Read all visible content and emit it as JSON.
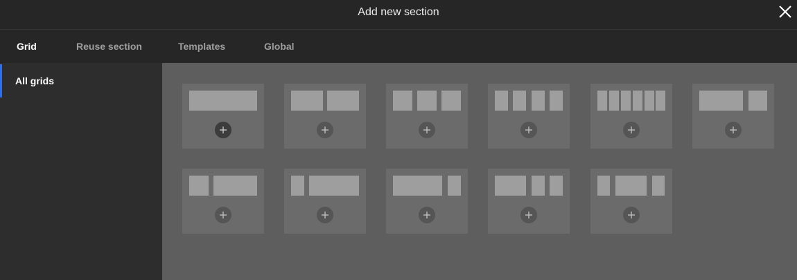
{
  "header": {
    "title": "Add new section",
    "close_icon": "close-icon"
  },
  "tabs": [
    {
      "label": "Grid",
      "active": true
    },
    {
      "label": "Reuse section",
      "active": false
    },
    {
      "label": "Templates",
      "active": false
    },
    {
      "label": "Global",
      "active": false
    }
  ],
  "sidebar": {
    "items": [
      {
        "label": "All grids",
        "active": true
      }
    ]
  },
  "colors": {
    "header_bg": "#262626",
    "sidebar_bg": "#2d2d2d",
    "content_bg": "#5e5e5e",
    "card_bg": "#6b6b6b",
    "block": "#9e9e9e",
    "active_indicator": "#2b6ef5"
  },
  "grid_layouts": [
    {
      "id": "1-col",
      "add_icon": "plus-icon"
    },
    {
      "id": "2-col-equal",
      "add_icon": "plus-icon"
    },
    {
      "id": "3-col-equal",
      "add_icon": "plus-icon"
    },
    {
      "id": "4-col-equal",
      "add_icon": "plus-icon"
    },
    {
      "id": "6-col-equal",
      "add_icon": "plus-icon"
    },
    {
      "id": "2-col-wide-narrow",
      "add_icon": "plus-icon"
    },
    {
      "id": "2-col-narrow-wide",
      "add_icon": "plus-icon"
    },
    {
      "id": "2-col-narrow-wider",
      "add_icon": "plus-icon"
    },
    {
      "id": "2-col-wider-narrow",
      "add_icon": "plus-icon"
    },
    {
      "id": "3-col-wide-narrow-narrow",
      "add_icon": "plus-icon"
    },
    {
      "id": "3-col-narrow-wide-narrow",
      "add_icon": "plus-icon"
    }
  ]
}
